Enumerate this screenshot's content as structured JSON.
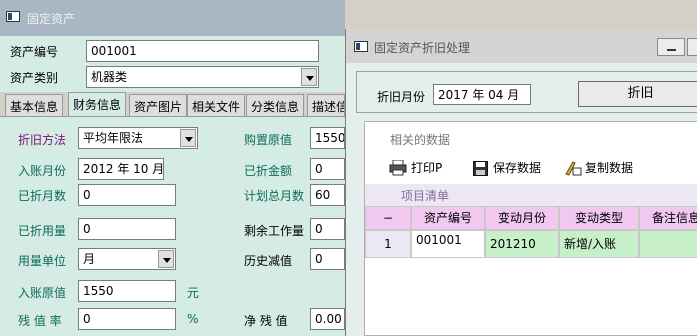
{
  "asset_window": {
    "title": "固定资产",
    "asset_no_label": "资产编号",
    "asset_no_value": "001001",
    "asset_cat_label": "资产类别",
    "asset_cat_value": "机器类",
    "tabs": [
      "基本信息",
      "财务信息",
      "资产图片",
      "相关文件",
      "分类信息",
      "描述信"
    ],
    "fields": {
      "method_label": "折旧方法",
      "method_value": "平均年限法",
      "entry_month_label": "入账月份",
      "entry_month_value": "2012 年 10 月",
      "dep_months_label": "已折月数",
      "dep_months_value": "0",
      "dep_usage_label": "已折用量",
      "dep_usage_value": "0",
      "usage_unit_label": "用量单位",
      "usage_unit_value": "月",
      "entry_value_label": "入账原值",
      "entry_value_value": "1550",
      "entry_value_unit": "元",
      "residual_rate_label": "残 值 率",
      "residual_rate_value": "0",
      "residual_rate_unit": "%",
      "purchase_value_label": "购置原值",
      "purchase_value_value": "1550",
      "dep_amount_label": "已折金额",
      "dep_amount_value": "0",
      "plan_months_label": "计划总月数",
      "plan_months_value": "60",
      "remaining_work_label": "剩余工作量",
      "remaining_work_value": "0",
      "history_dep_label": "历史减值",
      "history_dep_value": "0",
      "net_residual_label": "净 残 值",
      "net_residual_value": "0.00"
    }
  },
  "dep_window": {
    "title": "固定资产折旧处理",
    "dep_month_label": "折旧月份",
    "dep_month_value": "2017 年 04 月",
    "dep_button": "折旧",
    "related_data_label": "相关的数据",
    "toolbar": {
      "print": "打印P",
      "save": "保存数据",
      "copy": "复制数据"
    },
    "list_title": "项目清单",
    "grid": {
      "headers": [
        "−",
        "资产编号",
        "变动月份",
        "变动类型",
        "备注信息"
      ],
      "rows": [
        [
          "1",
          "001001",
          "201210",
          "新增/入账",
          ""
        ]
      ]
    }
  },
  "colors": {
    "panel_bg": "#d4ece4",
    "header_pink": "#f0c8f0",
    "cell_green": "#c8f0c8",
    "label_purple": "#7a0f7a",
    "label_green": "#0f6a5a"
  }
}
